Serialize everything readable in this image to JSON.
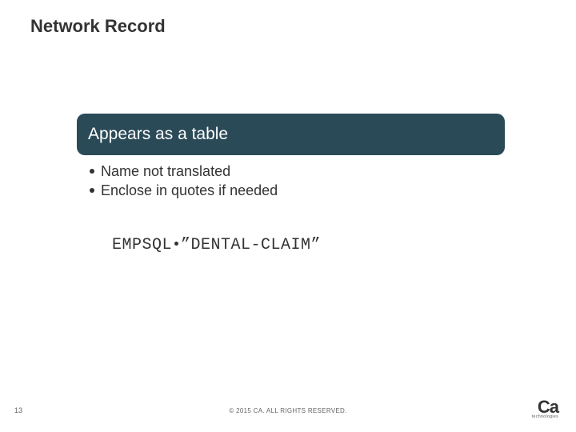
{
  "title": "Network Record",
  "header": "Appears as a table",
  "bullets": [
    "Name not translated",
    "Enclose in quotes if needed"
  ],
  "code": {
    "part1": "EMPSQL",
    "part2": "”DENTAL-CLAIM”"
  },
  "footer": {
    "page": "13",
    "copyright": "© 2015 CA. ALL RIGHTS RESERVED.",
    "logo_main": "Ca",
    "logo_sub": "technologies"
  }
}
